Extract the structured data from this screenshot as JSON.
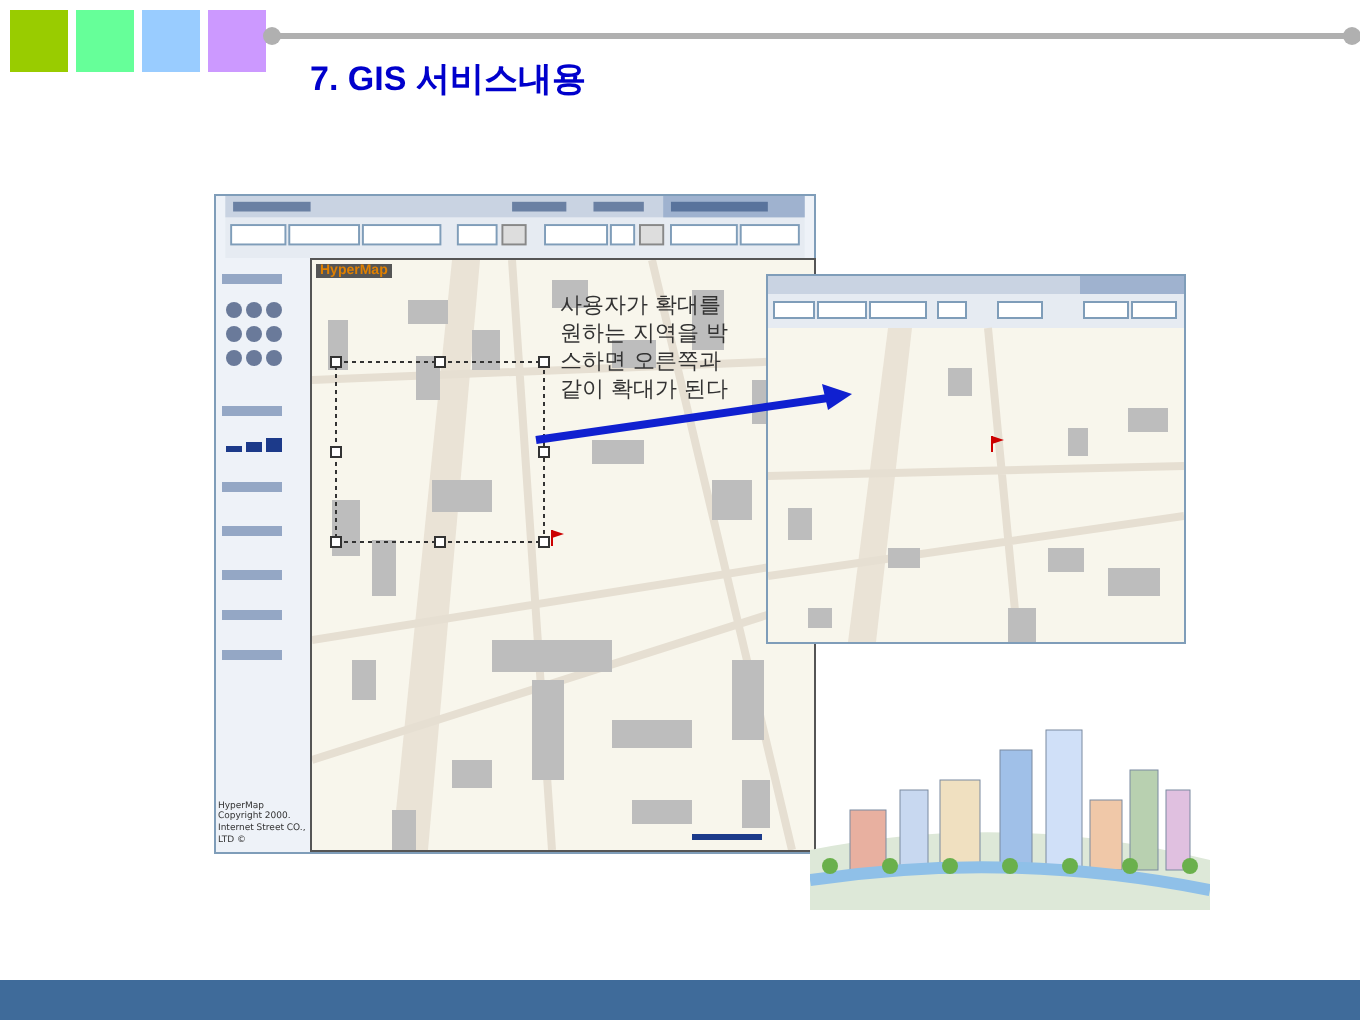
{
  "header": {
    "swatches": [
      {
        "color": "#99cc00"
      },
      {
        "color": "#66ff99"
      },
      {
        "color": "#99ccff"
      },
      {
        "color": "#cc99ff"
      }
    ]
  },
  "title": "7. GIS 서비스내용",
  "main_screenshot": {
    "map_logo": "HyperMap",
    "copyright_lines": [
      "HyperMap Copyright 2000.",
      "Internet Street CO., LTD ©"
    ]
  },
  "annotation": "사용자가 확대를 원하는 지역을 박스하면 오른쪽과 같이 확대가 된다"
}
